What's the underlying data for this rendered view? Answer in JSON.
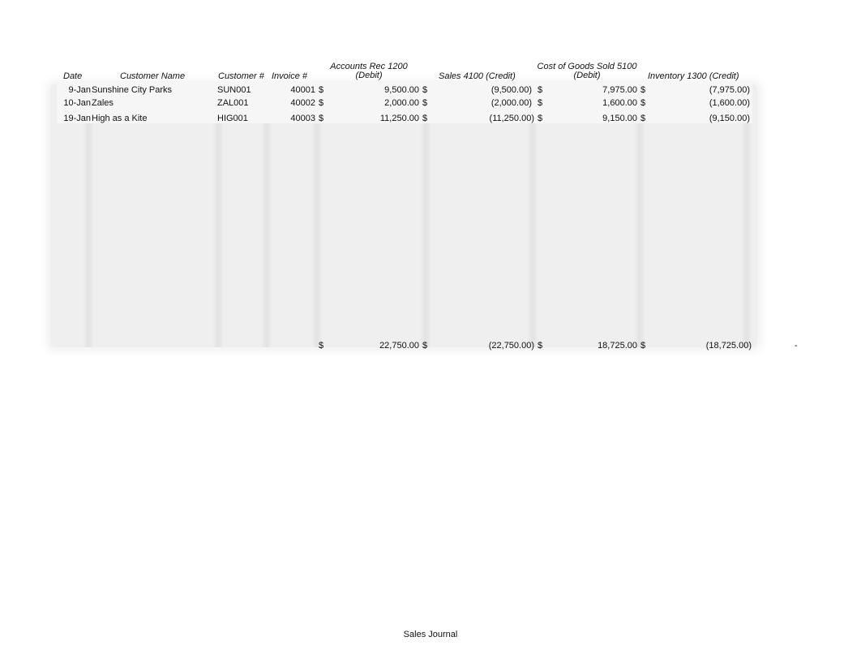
{
  "sheet": {
    "footer_title": "Sales Journal",
    "headers": {
      "date": "Date",
      "customer_name": "Customer Name",
      "customer_no": "Customer #",
      "invoice_no": "Invoice #",
      "ar_line1": "Accounts Rec 1200",
      "ar_line2": "(Debit)",
      "sales": "Sales 4100 (Credit)",
      "cogs_line1": "Cost of Goods Sold 5100",
      "cogs_line2": "(Debit)",
      "inventory": "Inventory 1300 (Credit)"
    },
    "currency_symbol": "$",
    "rows": [
      {
        "date": "9-Jan",
        "customer_name": "Sunshine City Parks",
        "customer_no": "SUN001",
        "invoice_no": "40001",
        "ar": "9,500.00",
        "sales": "(9,500.00)",
        "cogs": "7,975.00",
        "inventory": "(7,975.00)"
      },
      {
        "date": "10-Jan",
        "customer_name": "Zales",
        "customer_no": "ZAL001",
        "invoice_no": "40002",
        "ar": "2,000.00",
        "sales": "(2,000.00)",
        "cogs": "1,600.00",
        "inventory": "(1,600.00)"
      },
      {
        "date": "19-Jan",
        "customer_name": "High as a Kite",
        "customer_no": "HIG001",
        "invoice_no": "40003",
        "ar": "11,250.00",
        "sales": "(11,250.00)",
        "cogs": "9,150.00",
        "inventory": "(9,150.00)"
      }
    ],
    "totals": {
      "ar": "22,750.00",
      "sales": "(22,750.00)",
      "cogs": "18,725.00",
      "inventory": "(18,725.00)",
      "balance": "-"
    }
  }
}
